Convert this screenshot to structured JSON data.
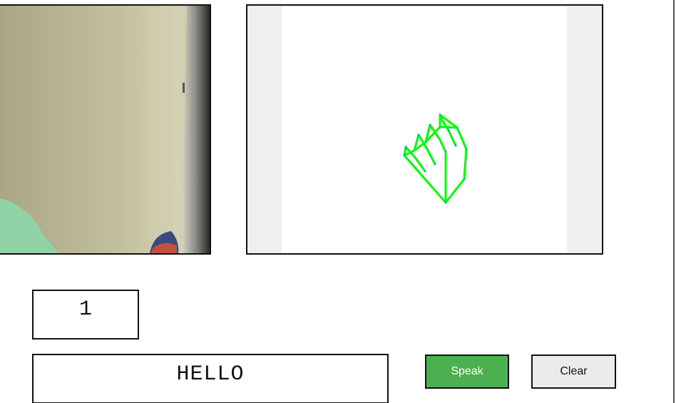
{
  "prediction": {
    "current_char": "1"
  },
  "sentence": {
    "text": "HELLO"
  },
  "buttons": {
    "speak_label": "Speak",
    "clear_label": "Clear"
  },
  "colors": {
    "speak_bg": "#4caf50",
    "clear_bg": "#ebebeb",
    "skeleton_line": "#00ff00",
    "skeleton_bg": "#ffffff",
    "canvas_pad": "#efefef"
  },
  "icons": {
    "hand_skeleton": "hand-landmark-skeleton-icon"
  }
}
